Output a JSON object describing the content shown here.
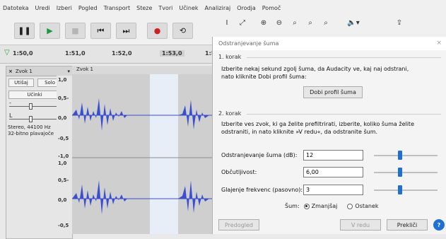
{
  "menu": [
    "Datoteka",
    "Uredi",
    "Izberi",
    "Pogled",
    "Transport",
    "Steze",
    "Tvori",
    "Učinek",
    "Analiziraj",
    "Orodja",
    "Pomoč"
  ],
  "ruler": {
    "ticks": [
      "1:50,0",
      "1:51,0",
      "1:52,0",
      "1:53,0",
      "1:5"
    ]
  },
  "track": {
    "name": "Zvok 1",
    "title": "Zvok 1",
    "mute": "Utišaj",
    "solo": "Solo",
    "effects": "Učinki",
    "gain_minus": "-",
    "gain_plus": "+",
    "pan_left": "L",
    "pan_right": "D",
    "info_line1": "Stereo, 44100 Hz",
    "info_line2": "32-bitno plavajoče",
    "scale_top": [
      "1,0",
      "0,5-",
      "0,0",
      "-0,5",
      "-1,0"
    ],
    "scale_bottom": [
      "1,0",
      "0,5-",
      "0,0",
      "-0,5"
    ]
  },
  "dialog": {
    "title": "Odstranjevanje šuma",
    "step1_header": "1. korak",
    "step1_text_line1": "Izberite nekaj sekund zgolj šuma, da Audacity ve, kaj naj odstrani,",
    "step1_text_line2": "nato kliknite Dobi profil šuma:",
    "get_profile": "Dobi profil šuma",
    "step2_header": "2. korak",
    "step2_text_line1": "Izberite ves zvok, ki ga želite prefiltrirati, izberite, koliko šuma želite",
    "step2_text_line2": "odstraniti, in nato kliknite »V redu«, da odstranite šum.",
    "params": [
      {
        "label": "Odstranjevanje šuma (dB):",
        "value": "12",
        "level": 0.4
      },
      {
        "label": "Občutljivost:",
        "value": "6,00",
        "level": 0.4
      },
      {
        "label": "Glajenje frekvenc (pasovno):",
        "value": "3",
        "level": 0.4
      }
    ],
    "noise_label": "Šum:",
    "opt_reduce": "Zmanjšaj",
    "opt_residue": "Ostanek",
    "preview": "Predogled",
    "ok": "V redu",
    "cancel": "Prekliči",
    "help": "?"
  }
}
